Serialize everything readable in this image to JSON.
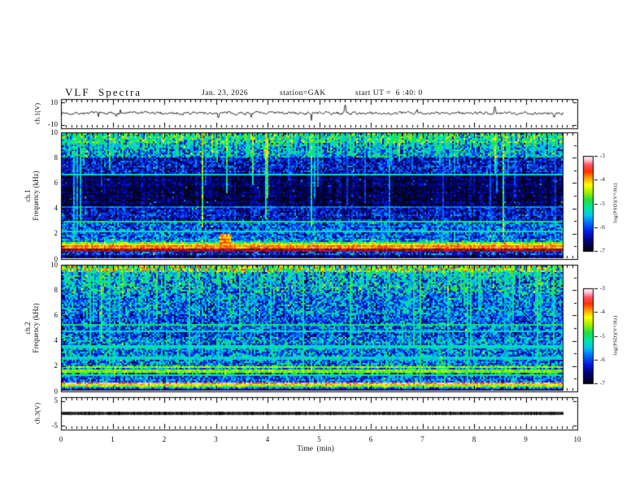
{
  "header": {
    "title": "VLF  Spectra",
    "date": "Jan. 23, 2026",
    "station": "station=GAK",
    "start_ut": "start UT =  6 :40: 0"
  },
  "x_axis": {
    "label": "Time  (min)",
    "min": 0,
    "max": 10,
    "major_ticks": [
      0,
      1,
      2,
      3,
      4,
      5,
      6,
      7,
      8,
      9,
      10
    ],
    "minor_step": 0.1,
    "data_end_min": 9.73
  },
  "colormap": [
    [
      0.0,
      "#04040f"
    ],
    [
      0.1,
      "#00006e"
    ],
    [
      0.2,
      "#0018e0"
    ],
    [
      0.3,
      "#0070ff"
    ],
    [
      0.38,
      "#00c8f0"
    ],
    [
      0.46,
      "#00e8a0"
    ],
    [
      0.54,
      "#20e040"
    ],
    [
      0.62,
      "#a0f000"
    ],
    [
      0.7,
      "#ffff00"
    ],
    [
      0.77,
      "#ffa000"
    ],
    [
      0.84,
      "#ff3000"
    ],
    [
      0.91,
      "#ff5064"
    ],
    [
      0.96,
      "#ffc4d2"
    ],
    [
      1.0,
      "#fff3f6"
    ]
  ],
  "chart_data": {
    "type": "heatmap",
    "title": "VLF Spectra",
    "xlabel": "Time  (min)",
    "xlim": [
      0,
      10
    ],
    "panels": [
      {
        "id": "ch1-waveform",
        "kind": "line",
        "ylabel": "ch.1(V)",
        "ylim": [
          -13,
          13
        ],
        "yticks": [
          10,
          -10
        ],
        "baseline_v": 0.5,
        "noise_amp_v": 1.3,
        "seed": 7,
        "spikes": [
          {
            "t": 1.15,
            "v": 3.6
          },
          {
            "t": 3.05,
            "v": -3.4
          },
          {
            "t": 4.85,
            "v": -6.0
          },
          {
            "t": 5.5,
            "v": 7.5
          },
          {
            "t": 6.9,
            "v": 3.8
          },
          {
            "t": 8.4,
            "v": 6.0
          },
          {
            "t": 9.55,
            "v": -3.0
          }
        ]
      },
      {
        "id": "ch1-spectrogram",
        "kind": "spectrogram",
        "ylabel_line1": "ch.1",
        "ylabel_line2": "Frequency (kHz)",
        "ylim": [
          0,
          10
        ],
        "yticks": [
          10,
          8,
          6,
          4,
          2,
          0
        ],
        "seed": 101,
        "bands": [
          {
            "lo": 9.2,
            "hi": 10.0,
            "base": 0.42,
            "var": 0.26
          },
          {
            "lo": 8.0,
            "hi": 9.2,
            "base": 0.34,
            "var": 0.22
          },
          {
            "lo": 6.8,
            "hi": 8.0,
            "base": 0.2,
            "var": 0.16
          },
          {
            "lo": 4.2,
            "hi": 6.8,
            "base": 0.08,
            "var": 0.1
          },
          {
            "lo": 3.0,
            "hi": 4.2,
            "base": 0.18,
            "var": 0.14
          },
          {
            "lo": 1.6,
            "hi": 3.0,
            "base": 0.27,
            "var": 0.17
          },
          {
            "lo": 1.35,
            "hi": 1.6,
            "base": 0.36,
            "var": 0.18
          },
          {
            "lo": 1.2,
            "hi": 1.35,
            "base": 0.58,
            "var": 0.12
          },
          {
            "lo": 1.0,
            "hi": 1.2,
            "base": 0.7,
            "var": 0.07
          },
          {
            "lo": 0.82,
            "hi": 1.0,
            "base": 0.8,
            "var": 0.06
          },
          {
            "lo": 0.72,
            "hi": 0.82,
            "base": 0.87,
            "var": 0.05
          },
          {
            "lo": 0.52,
            "hi": 0.72,
            "base": 0.5,
            "var": 0.3,
            "tint": "maroon"
          },
          {
            "lo": 0.3,
            "hi": 0.52,
            "base": 0.22,
            "var": 0.18
          },
          {
            "lo": 0.0,
            "hi": 0.3,
            "base": 0.1,
            "var": 0.1
          }
        ],
        "hlines": [
          {
            "f": 6.7,
            "i": 0.42
          },
          {
            "f": 4.05,
            "i": 0.3
          },
          {
            "f": 2.9,
            "i": 0.48
          },
          {
            "f": 2.15,
            "i": 0.44
          }
        ],
        "event": {
          "t": 3.17,
          "dur": 0.24,
          "f_lo": 0.8,
          "f_hi": 1.9,
          "i": 0.68
        },
        "streaks": {
          "density": 0.17,
          "boost_min": 0.25,
          "boost_max": 0.65,
          "top_density": 0.55,
          "top_boost": 0.3
        }
      },
      {
        "id": "ch2-spectrogram",
        "kind": "spectrogram",
        "ylabel_line1": "ch.2",
        "ylabel_line2": "Frequency (kHz)",
        "ylim": [
          0,
          10
        ],
        "yticks": [
          10,
          8,
          6,
          4,
          2,
          0
        ],
        "seed": 202,
        "bands": [
          {
            "lo": 9.5,
            "hi": 10.0,
            "base": 0.55,
            "var": 0.3
          },
          {
            "lo": 7.8,
            "hi": 9.5,
            "base": 0.36,
            "var": 0.24
          },
          {
            "lo": 6.0,
            "hi": 7.8,
            "base": 0.3,
            "var": 0.2
          },
          {
            "lo": 4.4,
            "hi": 6.0,
            "base": 0.26,
            "var": 0.18
          },
          {
            "lo": 2.2,
            "hi": 4.4,
            "base": 0.3,
            "var": 0.2
          },
          {
            "lo": 1.15,
            "hi": 2.2,
            "base": 0.3,
            "var": 0.2
          },
          {
            "lo": 0.65,
            "hi": 1.15,
            "base": 0.26,
            "var": 0.18
          },
          {
            "lo": 0.52,
            "hi": 0.65,
            "base": 0.93,
            "var": 0.05
          },
          {
            "lo": 0.4,
            "hi": 0.52,
            "base": 0.72,
            "var": 0.08
          },
          {
            "lo": 0.26,
            "hi": 0.4,
            "base": 0.56,
            "var": 0.1
          },
          {
            "lo": 0.17,
            "hi": 0.26,
            "base": 0.3,
            "var": 0.15
          },
          {
            "lo": 0.08,
            "hi": 0.17,
            "base": 0.84,
            "var": 0.05,
            "tint": "red"
          },
          {
            "lo": 0.0,
            "hi": 0.08,
            "base": 0.06,
            "var": 0.06
          }
        ],
        "hlines": [
          {
            "f": 5.3,
            "i": 0.5
          },
          {
            "f": 4.75,
            "i": 0.42
          },
          {
            "f": 3.5,
            "i": 0.42
          },
          {
            "f": 2.6,
            "i": 0.4
          },
          {
            "f": 1.9,
            "i": 0.62
          },
          {
            "f": 1.55,
            "i": 0.6
          },
          {
            "f": 1.2,
            "i": 0.5
          }
        ],
        "event": null,
        "streaks": {
          "density": 0.2,
          "boost_min": 0.2,
          "boost_max": 0.5,
          "top_density": 0.45,
          "top_boost": 0.25
        }
      },
      {
        "id": "ch3-line",
        "kind": "flatline",
        "ylabel": "ch.3(V)",
        "ylim": [
          -6.5,
          6.5
        ],
        "yticks": [
          5,
          -5
        ],
        "baseline_v": 0.0,
        "thickness_px": 3.2,
        "seed": 9
      }
    ],
    "colorbars": [
      {
        "label": "log(PSD)(V²/Hz)",
        "ticks": [
          -3,
          -4,
          -5,
          -6,
          -7
        ],
        "range": [
          -7,
          -3
        ]
      },
      {
        "label": "log(PSD)(V²/Hz)",
        "ticks": [
          -3,
          -4,
          -5,
          -6,
          -7
        ],
        "range": [
          -7,
          -3
        ]
      }
    ]
  }
}
